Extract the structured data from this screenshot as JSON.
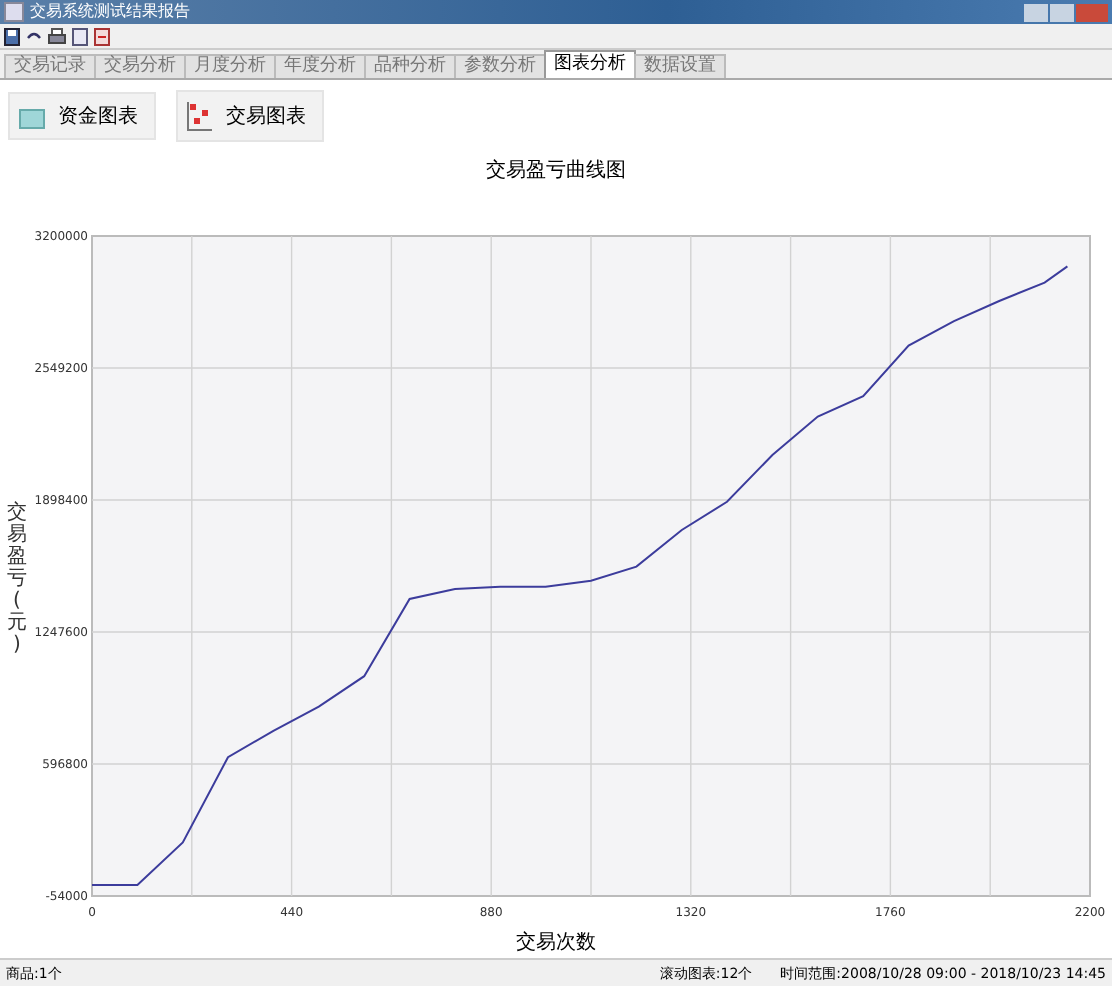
{
  "window": {
    "title": "交易系统测试结果报告"
  },
  "tabs": [
    {
      "label": "交易记录",
      "selected": false
    },
    {
      "label": "交易分析",
      "selected": false
    },
    {
      "label": "月度分析",
      "selected": false
    },
    {
      "label": "年度分析",
      "selected": false
    },
    {
      "label": "品种分析",
      "selected": false
    },
    {
      "label": "参数分析",
      "selected": false
    },
    {
      "label": "图表分析",
      "selected": true
    },
    {
      "label": "数据设置",
      "selected": false
    }
  ],
  "chart_buttons": [
    {
      "label": "资金图表"
    },
    {
      "label": "交易图表"
    }
  ],
  "chart": {
    "chart_data": {
      "type": "line",
      "title": "交易盈亏曲线图",
      "xlabel": "交易次数",
      "ylabel": "交易盈亏(元)",
      "x": [
        0,
        100,
        200,
        300,
        400,
        500,
        600,
        700,
        800,
        900,
        1000,
        1100,
        1200,
        1300,
        1400,
        1500,
        1600,
        1700,
        1800,
        1900,
        2000,
        2100,
        2150
      ],
      "series": [
        {
          "color": "#3c3c9c",
          "values": [
            0,
            0,
            210000,
            630000,
            760000,
            880000,
            1030000,
            1410000,
            1460000,
            1470000,
            1470000,
            1500000,
            1570000,
            1750000,
            1890000,
            2120000,
            2310000,
            2410000,
            2660000,
            2780000,
            2880000,
            2970000,
            3050000
          ]
        }
      ],
      "grid": true,
      "xlim": [
        0,
        2200
      ],
      "ylim": [
        -54000,
        3200000
      ],
      "xticks": [
        0,
        440,
        880,
        1320,
        1760,
        2200
      ],
      "yticks": [
        -54000,
        596800,
        1247600,
        1898400,
        2549200,
        3200000
      ]
    }
  },
  "status_bar": {
    "left": "商品:1个",
    "middle": "滚动图表:12个",
    "right": "时间范围:2008/10/28 09:00 - 2018/10/23 14:45"
  }
}
